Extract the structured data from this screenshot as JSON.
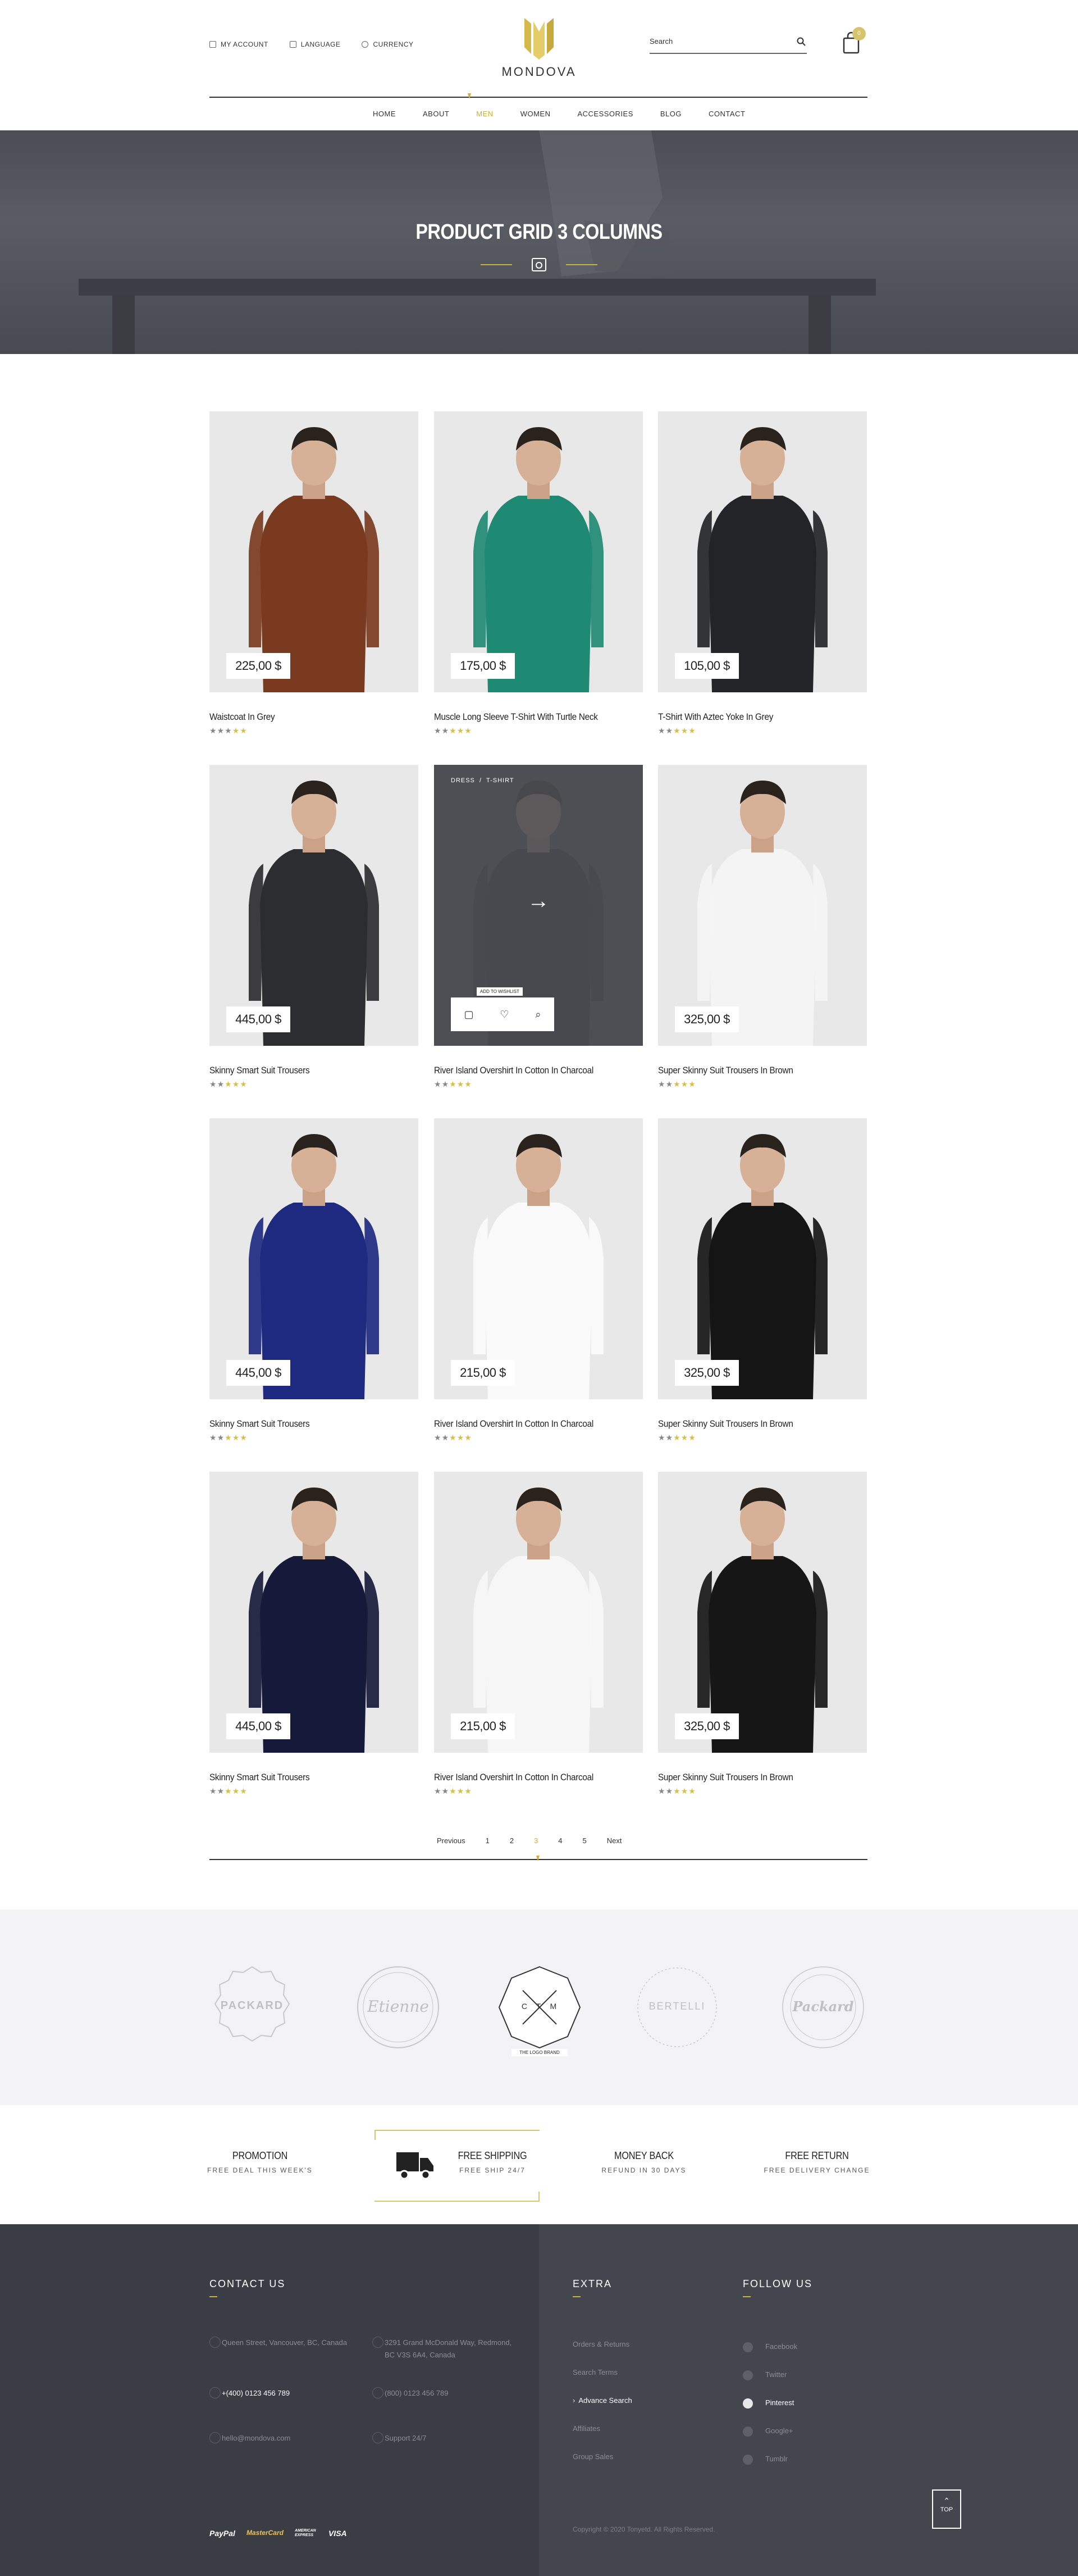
{
  "header": {
    "top_links": [
      {
        "icon": "user-icon",
        "label": "MY ACCOUNT"
      },
      {
        "icon": "bookmark-icon",
        "label": "LANGUAGE"
      },
      {
        "icon": "dollar-icon",
        "label": "CURRENCY"
      }
    ],
    "logo_text": "MONDOVA",
    "search_placeholder": "Search",
    "cart_count": "0",
    "nav": [
      "HOME",
      "ABOUT",
      "MEN",
      "WOMEN",
      "ACCESSORIES",
      "BLOG",
      "CONTACT"
    ],
    "nav_active": "MEN"
  },
  "banner": {
    "title": "PRODUCT GRID 3 COLUMNS"
  },
  "products": [
    {
      "price": "225,00 $",
      "title": "Waistcoat In Grey",
      "rating": 3,
      "shirt": "#7a3a20",
      "bg": "#e8e8e8"
    },
    {
      "price": "175,00 $",
      "title": "Muscle Long Sleeve T-Shirt With Turtle Neck",
      "rating": 2,
      "shirt": "#1f8a73",
      "bg": "#e8e8e8"
    },
    {
      "price": "105,00 $",
      "title": "T-Shirt With Aztec Yoke In Grey",
      "rating": 2,
      "shirt": "#222428",
      "bg": "#e8e8e8"
    },
    {
      "price": "445,00 $",
      "title": "Skinny Smart Suit Trousers",
      "rating": 2,
      "shirt": "#2c2d30",
      "bg": "#e8e8e8"
    },
    {
      "price": "",
      "title": "River Island Overshirt In Cotton In Charcoal",
      "rating": 2,
      "shirt": "#2b2c30",
      "bg": "#5b5d62",
      "hover": true
    },
    {
      "price": "325,00 $",
      "title": "Super Skinny Suit Trousers In Brown",
      "rating": 2,
      "shirt": "#f4f4f4",
      "bg": "#e8e8e8"
    },
    {
      "price": "445,00 $",
      "title": "Skinny Smart Suit Trousers",
      "rating": 2,
      "shirt": "#1d2a80",
      "bg": "#e8e8e8"
    },
    {
      "price": "215,00 $",
      "title": "River Island Overshirt In Cotton In Charcoal",
      "rating": 2,
      "shirt": "#fafafa",
      "bg": "#e8e8e8"
    },
    {
      "price": "325,00 $",
      "title": "Super Skinny Suit Trousers In Brown",
      "rating": 2,
      "shirt": "#151515",
      "bg": "#e8e8e8"
    },
    {
      "price": "445,00 $",
      "title": "Skinny Smart Suit Trousers",
      "rating": 2,
      "shirt": "#161a3a",
      "bg": "#e8e8e8"
    },
    {
      "price": "215,00 $",
      "title": "River Island Overshirt In Cotton In Charcoal",
      "rating": 2,
      "shirt": "#f6f6f6",
      "bg": "#e8e8e8"
    },
    {
      "price": "325,00 $",
      "title": "Super Skinny Suit Trousers In Brown",
      "rating": 2,
      "shirt": "#161616",
      "bg": "#e8e8e8"
    }
  ],
  "hover_card": {
    "tags": "DRESS  /  T-SHIRT",
    "tooltip": "ADD TO WISHLIST"
  },
  "pagination": {
    "prev": "Previous",
    "pages": [
      "1",
      "2",
      "3",
      "4",
      "5"
    ],
    "current": "3",
    "next": "Next"
  },
  "brands": [
    "PACKARD",
    "Etienne",
    "CTM",
    "BERTELLI",
    "Packard"
  ],
  "brand_active_caption": "THE LOGO BRAND",
  "features": [
    {
      "title": "PROMOTION",
      "subtitle": "FREE DEAL THIS WEEK'S"
    },
    {
      "title": "FREE SHIPPING",
      "subtitle": "FREE SHIP 24/7"
    },
    {
      "title": "MONEY BACK",
      "subtitle": "REFUND IN 30 DAYS"
    },
    {
      "title": "FREE RETURN",
      "subtitle": "FREE DELIVERY CHANGE"
    }
  ],
  "footer": {
    "contact_title": "CONTACT US",
    "contact": [
      {
        "text": "Queen Street, Vancouver, BC, Canada",
        "highlight": false
      },
      {
        "text": "3291 Grand McDonald Way, Redmond, BC V3S 6A4, Canada",
        "highlight": false
      },
      {
        "text": "+(400) 0123 456 789",
        "highlight": true
      },
      {
        "text": "(800) 0123 456 789",
        "highlight": false
      },
      {
        "text": "hello@mondova.com",
        "highlight": false
      },
      {
        "text": "Support 24/7",
        "highlight": false
      }
    ],
    "extra_title": "EXTRA",
    "extra": [
      "Orders & Returns",
      "Search Terms",
      "Advance Search",
      "Affiliates",
      "Group Sales"
    ],
    "extra_active": "Advance Search",
    "follow_title": "FOLLOW US",
    "follow": [
      "Facebook",
      "Twitter",
      "Pinterest",
      "Google+",
      "Tumblr"
    ],
    "follow_active": "Pinterest",
    "payments": [
      "PayPal",
      "MasterCard",
      "AMERICAN EXPRESS",
      "VISA"
    ],
    "copyright": "Copyright © 2020 Tonyetd. All Rights Reserved.",
    "top_label": "TOP"
  }
}
